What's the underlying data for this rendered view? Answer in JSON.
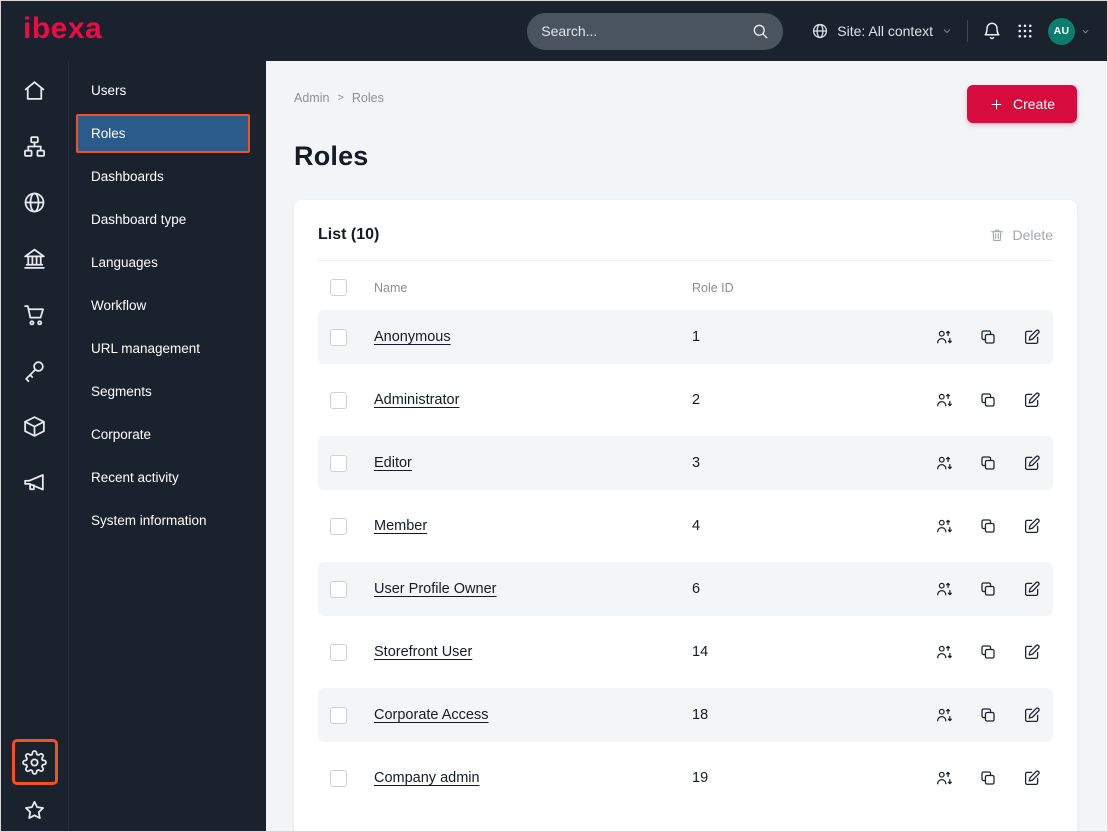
{
  "topbar": {
    "logo_text": "ibexa",
    "search_placeholder": "Search...",
    "site_context_label": "Site: All context",
    "avatar_initials": "AU"
  },
  "icon_rail": {
    "top_icons": [
      "home",
      "content-tree",
      "globe",
      "building",
      "cart",
      "permissions",
      "products",
      "marketing"
    ],
    "bottom_icons": [
      "settings",
      "bookmarks"
    ],
    "highlighted_icon": "settings"
  },
  "sidebar": {
    "items": [
      {
        "label": "Users",
        "active": false
      },
      {
        "label": "Roles",
        "active": true
      },
      {
        "label": "Dashboards",
        "active": false
      },
      {
        "label": "Dashboard type",
        "active": false
      },
      {
        "label": "Languages",
        "active": false
      },
      {
        "label": "Workflow",
        "active": false
      },
      {
        "label": "URL management",
        "active": false
      },
      {
        "label": "Segments",
        "active": false
      },
      {
        "label": "Corporate",
        "active": false
      },
      {
        "label": "Recent activity",
        "active": false
      },
      {
        "label": "System information",
        "active": false
      }
    ]
  },
  "main": {
    "breadcrumb": {
      "items": [
        "Admin",
        "Roles"
      ],
      "separator": ">"
    },
    "create_button_label": "Create",
    "page_title": "Roles",
    "list": {
      "title": "List (10)",
      "delete_button_label": "Delete",
      "columns": {
        "name": "Name",
        "role_id": "Role ID"
      },
      "row_action_icons": [
        "assign-users",
        "copy",
        "edit"
      ],
      "rows": [
        {
          "name": "Anonymous",
          "role_id": "1"
        },
        {
          "name": "Administrator",
          "role_id": "2"
        },
        {
          "name": "Editor",
          "role_id": "3"
        },
        {
          "name": "Member",
          "role_id": "4"
        },
        {
          "name": "User Profile Owner",
          "role_id": "6"
        },
        {
          "name": "Storefront User",
          "role_id": "14"
        },
        {
          "name": "Corporate Access",
          "role_id": "18"
        },
        {
          "name": "Company admin",
          "role_id": "19"
        }
      ]
    }
  },
  "colors": {
    "topbar_bg": "#19222d",
    "brand_red": "#ed0a45",
    "create_button_red": "#d80b3f",
    "highlight_orange": "#f4511e",
    "active_item_blue": "#2a5b8b",
    "avatar_teal": "#0e7d6e",
    "main_bg": "#f3f4f6",
    "stripe_bg": "#f4f5f6",
    "text_dark": "#131c26"
  }
}
